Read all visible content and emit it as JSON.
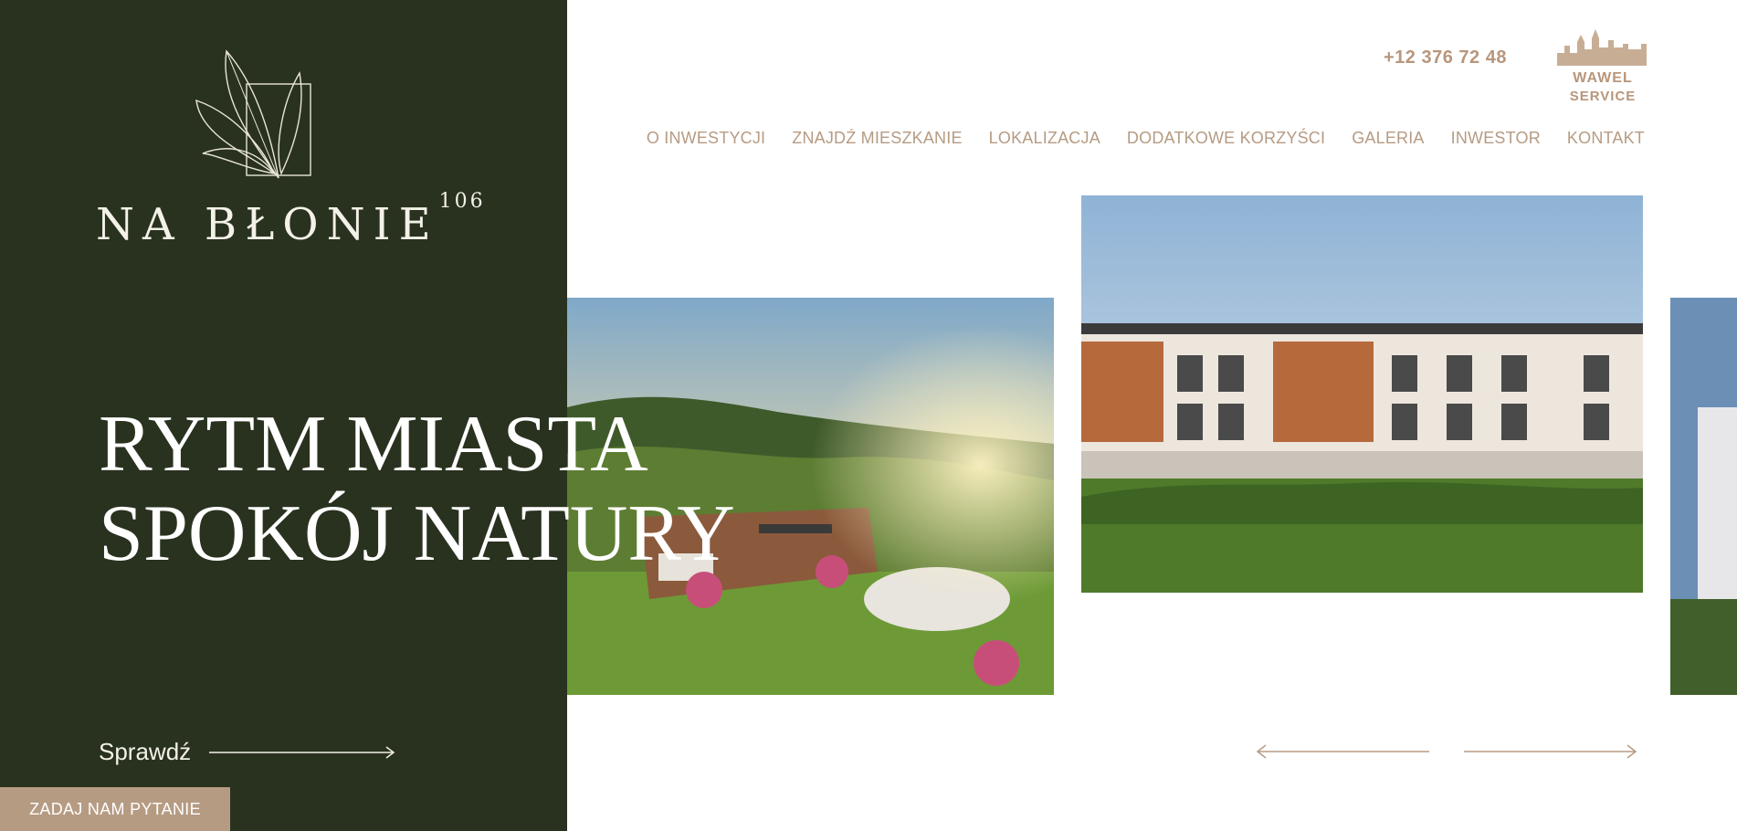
{
  "brand": {
    "name": "NA BŁONIE",
    "superscript": "106",
    "logo_icon": "leaves-square-logo"
  },
  "hero": {
    "line1": "RYTM MIASTA",
    "line2": "SPOKÓJ NATURY",
    "cta_label": "Sprawdź",
    "cta_icon": "long-arrow-right-icon"
  },
  "ask_button": {
    "label": "ZADAJ NAM PYTANIE"
  },
  "header": {
    "phone": "+12 376 72 48",
    "partner_logo": {
      "line1": "WAWEL",
      "line2": "SERVICE",
      "icon": "wawel-castle-icon"
    }
  },
  "nav": {
    "items": [
      {
        "label": "O INWESTYCJI"
      },
      {
        "label": "ZNAJDŹ MIESZKANIE"
      },
      {
        "label": "LOKALIZACJA"
      },
      {
        "label": "DODATKOWE KORZYŚCI"
      },
      {
        "label": "GALERIA"
      },
      {
        "label": "INWESTOR"
      },
      {
        "label": "KONTAKT"
      }
    ]
  },
  "slider": {
    "prev_icon": "long-arrow-left-icon",
    "next_icon": "long-arrow-right-icon"
  },
  "colors": {
    "sidebar": "#29321f",
    "accent": "#b69b83",
    "text_light": "#f3f1e8"
  }
}
